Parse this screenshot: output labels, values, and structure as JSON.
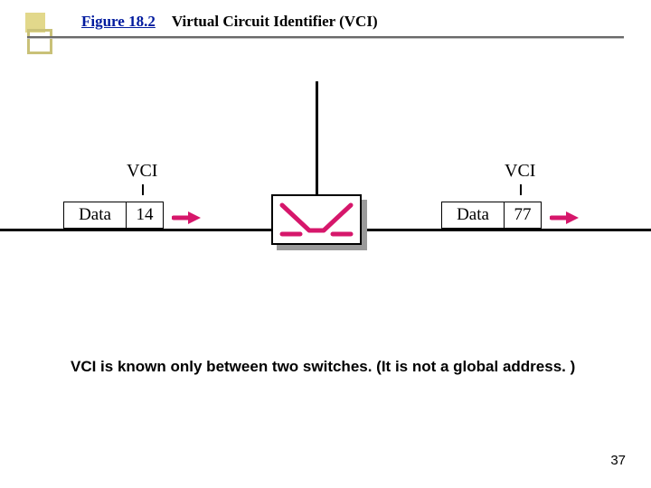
{
  "header": {
    "figure_label": "Figure 18.2",
    "figure_title": "Virtual Circuit Identifier (VCI)"
  },
  "diagram": {
    "vci_label_left": "VCI",
    "vci_label_right": "VCI",
    "packet_left": {
      "data_label": "Data",
      "vci_value": "14"
    },
    "packet_right": {
      "data_label": "Data",
      "vci_value": "77"
    }
  },
  "caption": "VCI is known only between two switches.  (It is not a global address. )",
  "page_number": "37"
}
